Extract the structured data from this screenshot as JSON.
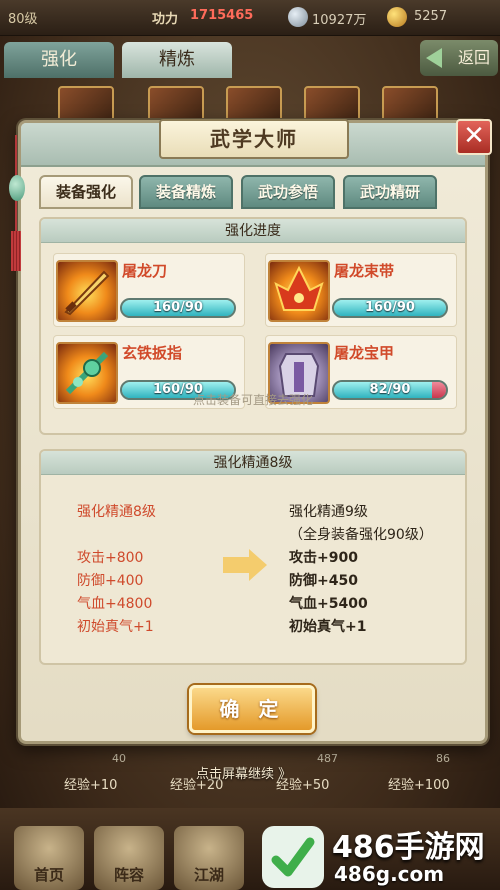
{
  "top_bar": {
    "level": "80级",
    "power_label": "功力",
    "power_value": "1715465",
    "silver": "10927万",
    "gold": "5257"
  },
  "background": {
    "tab_enhance": "强化",
    "tab_refine": "精炼",
    "back_label": "返回",
    "exp_values": [
      "40",
      "",
      "487",
      "86"
    ],
    "exp_labels": [
      "经验+10",
      "经验+20",
      "经验+50",
      "经验+100"
    ],
    "continue_hint": "点击屏幕继续 》",
    "nav": [
      "首页",
      "阵容",
      "江湖"
    ]
  },
  "dialog": {
    "title": "武学大师",
    "close_symbol": "✕",
    "tabs": [
      {
        "label": "装备强化",
        "active": true
      },
      {
        "label": "装备精炼",
        "active": false
      },
      {
        "label": "武功参悟",
        "active": false
      },
      {
        "label": "武功精研",
        "active": false
      }
    ],
    "progress": {
      "title": "强化进度",
      "items": [
        {
          "name": "屠龙刀",
          "progress_text": "160/90",
          "fill": 1.0
        },
        {
          "name": "屠龙束带",
          "progress_text": "160/90",
          "fill": 1.0
        },
        {
          "name": "玄铁扳指",
          "progress_text": "160/90",
          "fill": 1.0
        },
        {
          "name": "屠龙宝甲",
          "progress_text": "82/90",
          "fill": 0.911
        }
      ],
      "hint": "点击装备可直接去强化"
    },
    "mastery": {
      "title": "强化精通8级",
      "current": {
        "level": "强化精通8级",
        "attack": "攻击+800",
        "defense": "防御+400",
        "hp": "气血+4800",
        "qi": "初始真气+1"
      },
      "next": {
        "level": "强化精通9级",
        "condition": "（全身装备强化90级）",
        "attack": "攻击+900",
        "defense": "防御+450",
        "hp": "气血+5400",
        "qi": "初始真气+1"
      }
    },
    "confirm_label": "确 定"
  },
  "watermark": {
    "title": "486手游网",
    "url": "486g.com"
  },
  "colors": {
    "accent_teal": "#5f8a80",
    "name_red": "#d14a2a",
    "button_gold": "#e49a2a"
  }
}
